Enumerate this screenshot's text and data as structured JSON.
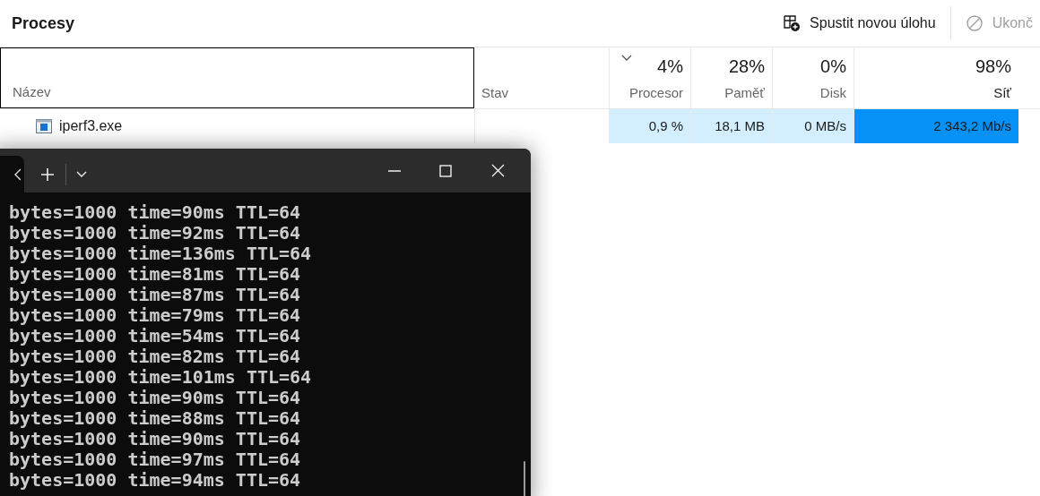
{
  "header": {
    "title": "Procesy",
    "actions": [
      {
        "label": "Spustit novou úlohu",
        "kind": "new-task",
        "disabled": false
      },
      {
        "label": "Ukonč",
        "kind": "end-task",
        "disabled": true
      }
    ]
  },
  "table": {
    "columns": [
      {
        "label": "Název",
        "sorted": false,
        "focused": true
      },
      {
        "label": "Stav",
        "sorted": false,
        "focused": false
      },
      {
        "label": "Procesor",
        "percent": "4%",
        "sorted": true,
        "focused": false
      },
      {
        "label": "Paměť",
        "percent": "28%",
        "sorted": false,
        "focused": false
      },
      {
        "label": "Disk",
        "percent": "0%",
        "sorted": false,
        "focused": false
      },
      {
        "label": "Síť",
        "percent": "98%",
        "sorted": false,
        "focused": false
      }
    ],
    "rows": [
      {
        "cells": [
          {
            "value": "iperf3.exe",
            "kind": "name"
          },
          {
            "kind": "status"
          },
          {
            "value": "0,9 %",
            "color": "#d3efff"
          },
          {
            "value": "18,1 MB",
            "color": "#d3efff"
          },
          {
            "value": "0 MB/s",
            "color": "#d3efff"
          },
          {
            "value": "2 343,2 Mb/s",
            "color": "#0591f5"
          }
        ]
      }
    ]
  },
  "terminal": {
    "lines": [
      "bytes=1000 time=90ms TTL=64",
      "bytes=1000 time=92ms TTL=64",
      "bytes=1000 time=136ms TTL=64",
      "bytes=1000 time=81ms TTL=64",
      "bytes=1000 time=87ms TTL=64",
      "bytes=1000 time=79ms TTL=64",
      "bytes=1000 time=54ms TTL=64",
      "bytes=1000 time=82ms TTL=64",
      "bytes=1000 time=101ms TTL=64",
      "bytes=1000 time=90ms TTL=64",
      "bytes=1000 time=88ms TTL=64",
      "bytes=1000 time=90ms TTL=64",
      "bytes=1000 time=97ms TTL=64",
      "bytes=1000 time=94ms TTL=64"
    ]
  }
}
